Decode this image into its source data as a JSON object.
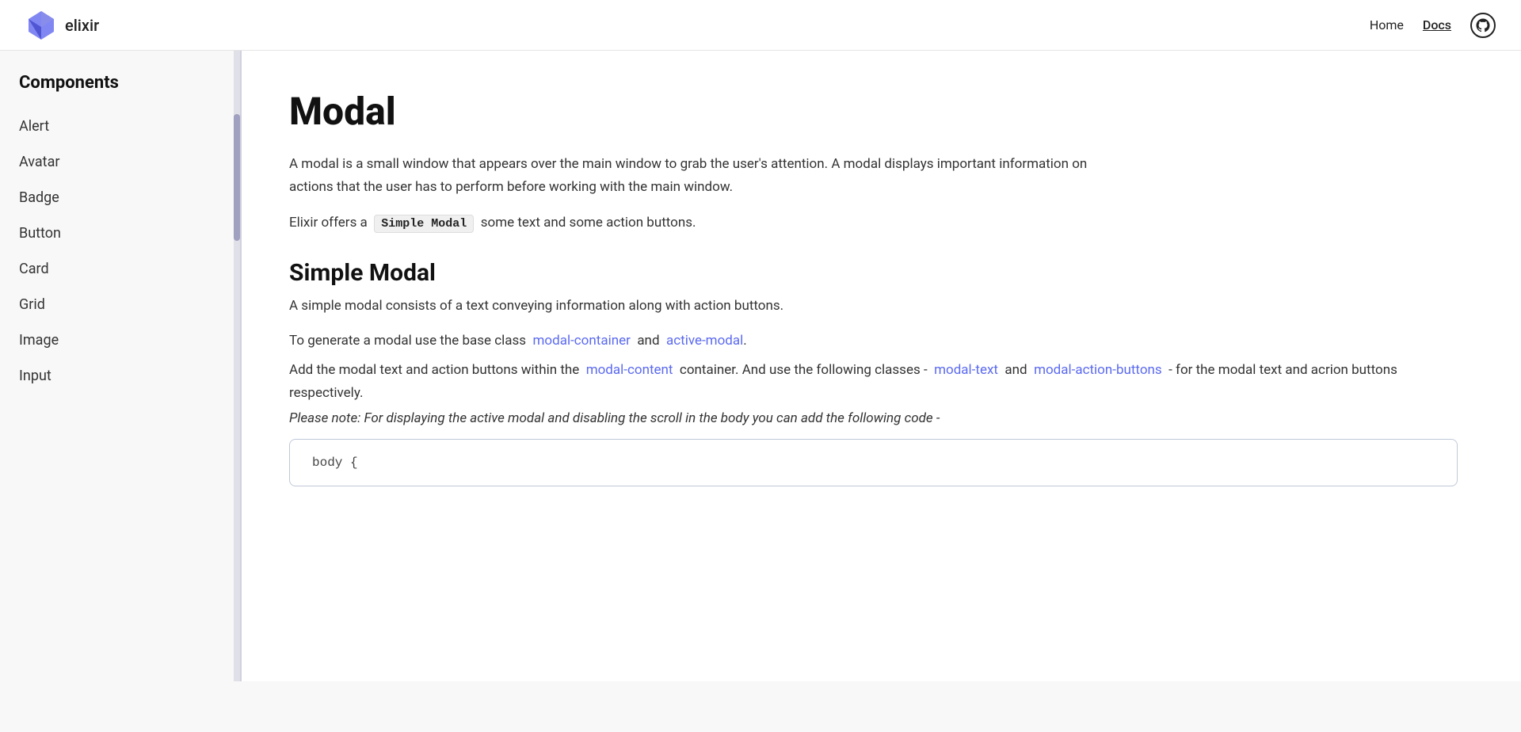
{
  "header": {
    "logo_text": "elixir",
    "nav_home": "Home",
    "nav_docs": "Docs"
  },
  "sidebar": {
    "title": "Components",
    "items": [
      {
        "label": "Alert"
      },
      {
        "label": "Avatar"
      },
      {
        "label": "Badge"
      },
      {
        "label": "Button"
      },
      {
        "label": "Card"
      },
      {
        "label": "Grid"
      },
      {
        "label": "Image"
      },
      {
        "label": "Input"
      }
    ]
  },
  "main": {
    "page_title": "Modal",
    "intro_paragraph": "A modal is a small window that appears over the main window to grab the user's attention. A modal displays important information on actions that the user has to perform before working with the main window.",
    "offers_text_before": "Elixir offers a",
    "offers_inline_code": "Simple Modal",
    "offers_text_after": "some text and some action buttons.",
    "section1_title": "Simple Modal",
    "section1_desc": "A simple modal consists of a text conveying information along with action buttons.",
    "instruction1_before": "To generate a modal use the base class",
    "instruction1_link1": "modal-container",
    "instruction1_mid": "and",
    "instruction1_link2": "active-modal",
    "instruction1_after": ".",
    "instruction2_before": "Add the modal text and action buttons within the",
    "instruction2_link1": "modal-content",
    "instruction2_mid": "container. And use the following classes -",
    "instruction2_link2": "modal-text",
    "instruction2_mid2": "and",
    "instruction2_link3": "modal-action-buttons",
    "instruction2_after": "- for the modal text and acrion buttons respectively.",
    "note_text": "Please note: For displaying the active modal and disabling the scroll in the body you can add the following code -",
    "code_snippet": "body {"
  }
}
